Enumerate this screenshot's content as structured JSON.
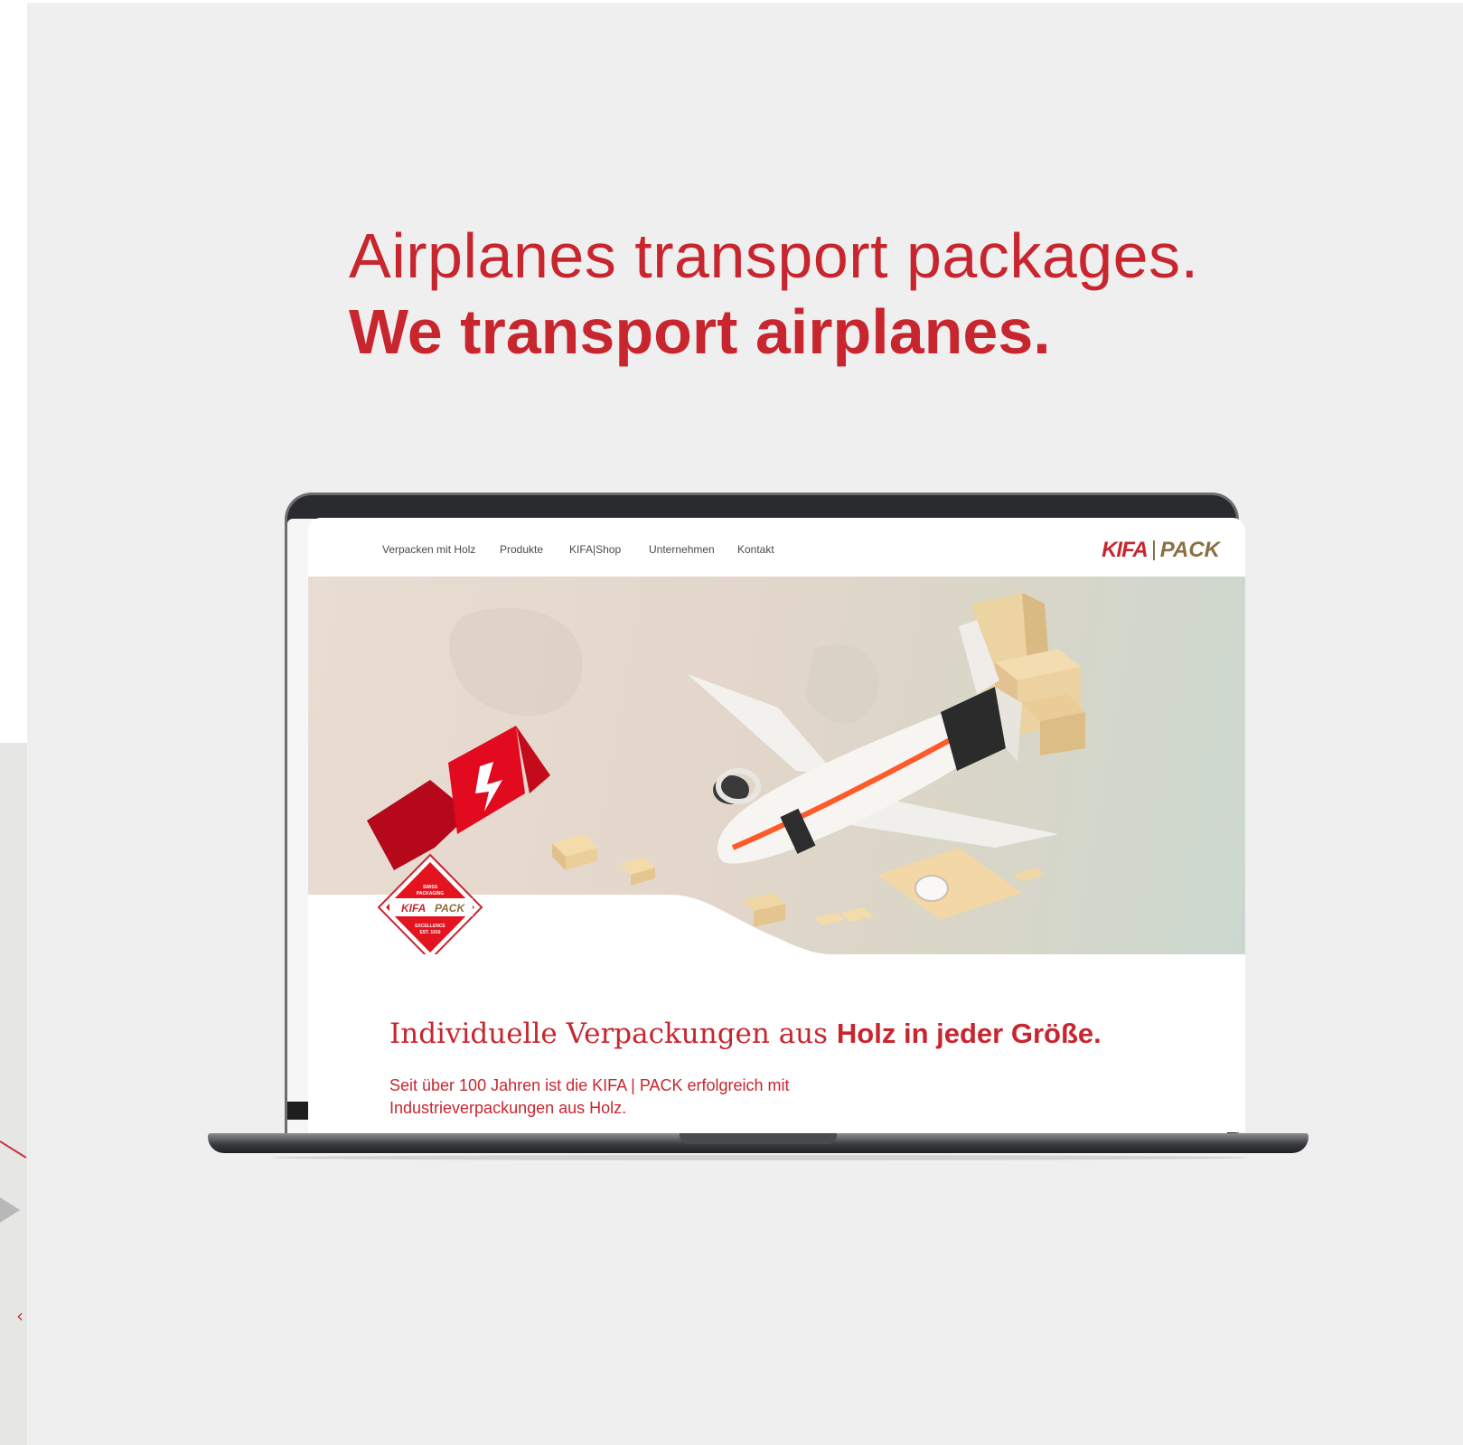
{
  "headline": {
    "line1": "Airplanes transport packages.",
    "line2": "We transport airplanes."
  },
  "website": {
    "nav": [
      "Verpacken mit Holz",
      "Produkte",
      "KIFA|Shop",
      "Unternehmen",
      "Kontakt"
    ],
    "brand": {
      "part1": "KIFA",
      "part2": "PACK"
    },
    "badge": {
      "top": "SWISS PACKAGING",
      "brand1": "KIFA",
      "brand2": "PACK",
      "bottom": "EXCELLENCE EST. 1919"
    },
    "tagline_regular": "Individuelle Verpackungen aus ",
    "tagline_bold": "Holz in jeder Größe.",
    "intro": "Seit über 100 Jahren ist die KIFA | PACK erfolgreich mit Industrieverpackungen aus Holz."
  },
  "colors": {
    "accent": "#c8262f",
    "brand_gold": "#8a7042",
    "background": "#efefef"
  }
}
